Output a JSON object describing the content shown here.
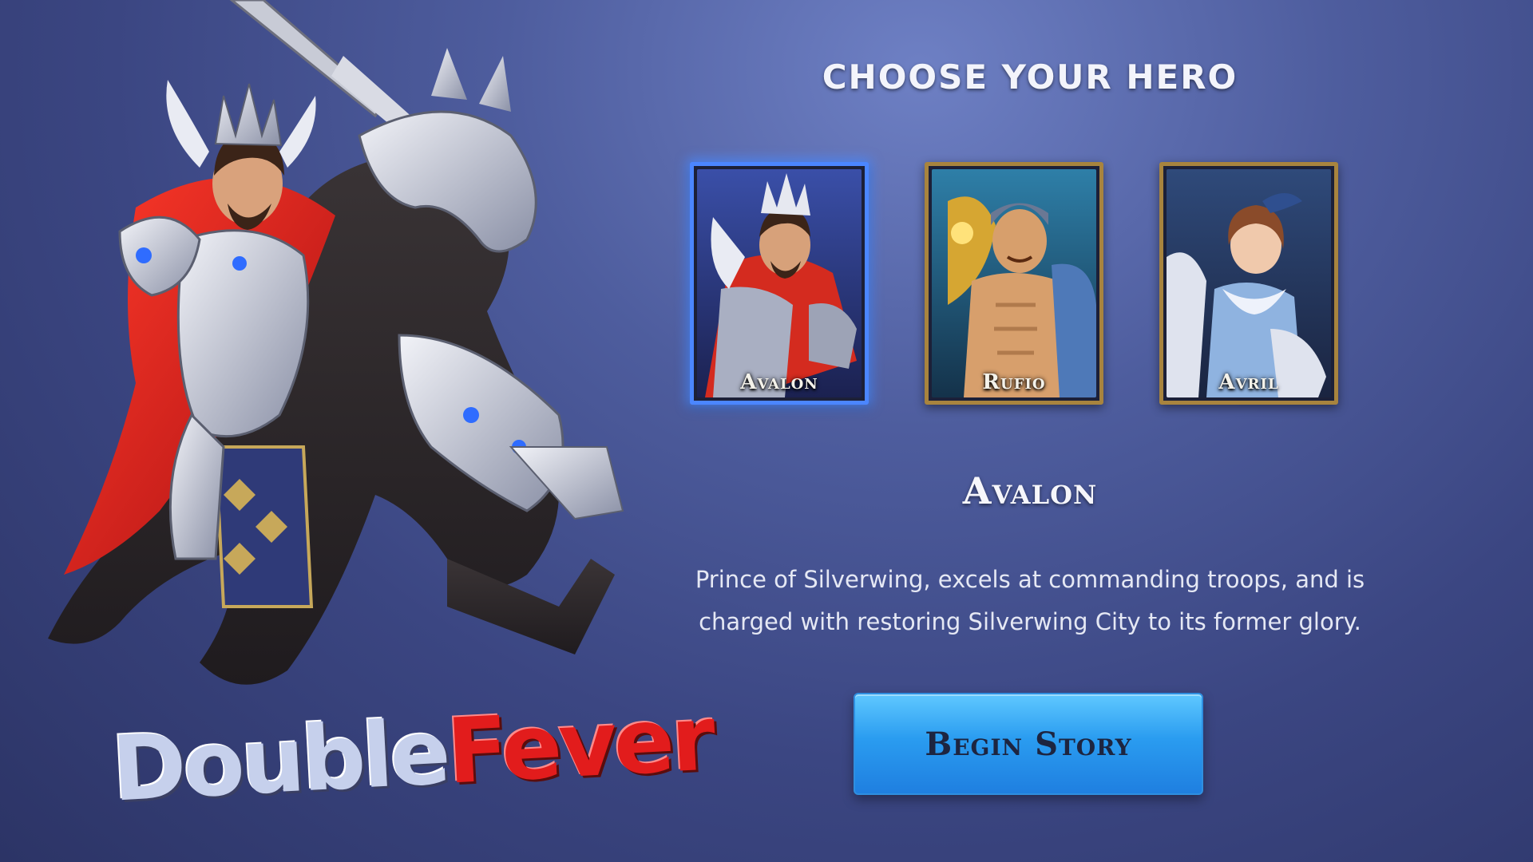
{
  "screen": {
    "title": "CHOOSE YOUR HERO"
  },
  "heroes": [
    {
      "name": "Avalon",
      "selected": true,
      "portrait_icon": "knight-portrait-icon"
    },
    {
      "name": "Rufio",
      "selected": false,
      "portrait_icon": "warrior-portrait-icon"
    },
    {
      "name": "Avril",
      "selected": false,
      "portrait_icon": "mage-portrait-icon"
    }
  ],
  "selected_hero": {
    "name": "Avalon",
    "description": "Prince of Silverwing, excels at commanding troops, and is charged with restoring Silverwing City to its former glory."
  },
  "actions": {
    "begin_label": "Begin Story"
  },
  "watermark": {
    "part1": "Double",
    "part2": "Fever"
  },
  "colors": {
    "selected_border": "#4b86ff",
    "card_border": "#a8843e",
    "button": "#2a9cf0",
    "watermark_accent": "#e21c1c"
  }
}
